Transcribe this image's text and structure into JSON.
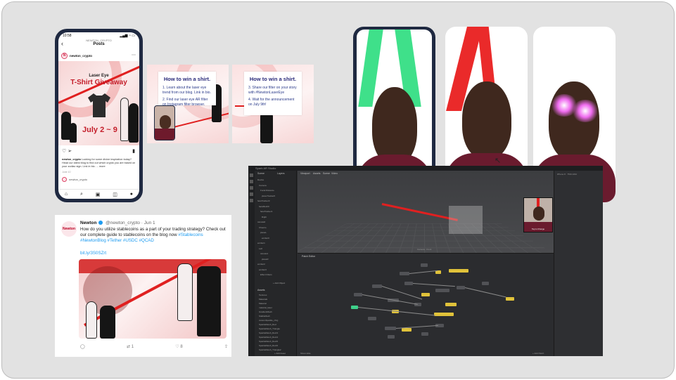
{
  "instagram": {
    "status_time": "10:58",
    "status_right": "▂▄▆ ◔ ▭",
    "account_small": "NEWTON_CRYPTO",
    "header_title": "Posts",
    "avatar_letter": "N",
    "username": "newton_crypto",
    "post_headline": "Laser Eye",
    "post_title": "T-Shirt Giveaway",
    "post_dates": "July 2 ~ 9",
    "caption_handle": "newton_crypto",
    "caption_text": "Looking for some divine inspiration today? Head our latest blog to find out which crypto you are based on your zodiac sign. Link in bio. ... more",
    "time_ago": "June 10",
    "comment_user": "newton_crypto"
  },
  "slides": [
    {
      "title": "How to win a shirt.",
      "steps": [
        "1. Learn about the laser eye trend from our blog. Link in bio.",
        "2. Find our laser eye AR filter on Instagram filter browser."
      ]
    },
    {
      "title": "How to win a shirt.",
      "steps": [
        "3. Share our filter on your story with #NewtonLaserEye",
        "4. Wait for the announcement on July 9th!"
      ]
    }
  ],
  "tweet": {
    "avatar_label": "Newton",
    "name": "Newton",
    "handle": "@newton_crypto · Jun 1",
    "text": "How do you utilize stablecoins as a part of your trading strategy? Check out our complete guide to stablecoins on the blog now",
    "tags": "#Stablecoins #NewtonBlog #Tether #USDC #QCAD",
    "link": "bit.ly/3S0SZrt",
    "retweets": "1",
    "likes": "8"
  },
  "spark": {
    "app_title": "Spark AR Studio",
    "tab_scene": "Scene",
    "tab_layers": "Layers",
    "viewport_tabs": [
      "Viewport",
      "Assets",
      "Scene",
      "Video"
    ],
    "scene_tree": [
      "Device",
      "Camera",
      "Focal Distance",
      "planeTracker0",
      "faceTracker0",
      "faceMesh0",
      "faceTracker1",
      "Right",
      "canvas0",
      "Cheerio",
      "planeL",
      "emitter0",
      "emitter1",
      "Left",
      "canvas1",
      "planeR",
      "emitter2",
      "emitter3",
      "Effect Filters"
    ],
    "add_object": "+ Add Object",
    "assets_title": "Assets",
    "assets": [
      "Textures",
      "Materials",
      "Material",
      "material_laser",
      "GradientMesh",
      "StableMesh",
      "customSparkle_chrg",
      "SparkleMesh_Red",
      "SparkleMesh_Triangle",
      "SparkleMesh_Rect3",
      "SparkleMesh_Rect4",
      "SparkleMesh_Rect5",
      "SparkleMesh_Rect6",
      "SparkleMesh_Triangle2"
    ],
    "add_asset": "+ Add Asset",
    "camera_label": "Camera · Front",
    "simulator_label": "Tap to Change",
    "patch_title": "Patch Editor",
    "show_hide": "Show Hide",
    "add_patch": "+ Add Patch",
    "right_meta": "iPhone 8 · 750×1334"
  }
}
